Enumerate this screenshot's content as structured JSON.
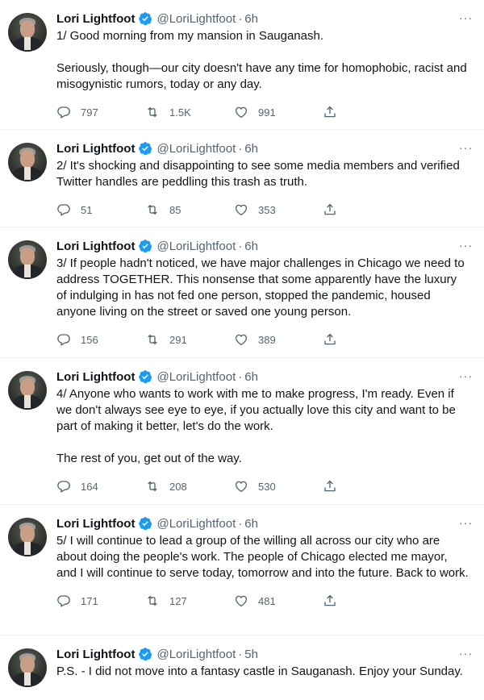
{
  "author": {
    "name": "Lori Lightfoot",
    "handle": "@LoriLightfoot"
  },
  "separator": "·",
  "more_label": "···",
  "tweets": [
    {
      "time": "6h",
      "text": "1/ Good morning from my mansion in Sauganash.\n\nSeriously, though—our city doesn't have any time for homophobic, racist and misogynistic rumors, today or any day.",
      "replies": "797",
      "retweets": "1.5K",
      "likes": "991"
    },
    {
      "time": "6h",
      "text": "2/ It's shocking and disappointing to see some media members and verified Twitter handles are peddling this trash as truth.",
      "replies": "51",
      "retweets": "85",
      "likes": "353"
    },
    {
      "time": "6h",
      "text": "3/ If people hadn't noticed, we have major challenges in Chicago we need to address TOGETHER. This nonsense that some apparently have the luxury of indulging in has not fed one person, stopped the pandemic, housed anyone living on the street or saved one young person.",
      "replies": "156",
      "retweets": "291",
      "likes": "389"
    },
    {
      "time": "6h",
      "text": "4/ Anyone who wants to work with me to make progress, I'm ready. Even if we don't always see eye to eye, if you actually love this city and want to be part of making it better, let's do the work.\n\nThe rest of you, get out of the way.",
      "replies": "164",
      "retweets": "208",
      "likes": "530"
    },
    {
      "time": "6h",
      "text": "5/ I will continue to lead a group of the willing all across our city who are about doing the people's work. The people of Chicago elected me mayor, and I will continue to serve today, tomorrow and into the future. Back to work.",
      "replies": "171",
      "retweets": "127",
      "likes": "481"
    },
    {
      "time": "5h",
      "text": "P.S. - I did not move into a fantasy castle in Sauganash. Enjoy your Sunday.",
      "replies": "",
      "retweets": "",
      "likes": ""
    }
  ],
  "colors": {
    "verified": "#1d9bf0",
    "secondary_text": "#536471",
    "divider": "#eff3f4"
  },
  "icons": [
    "verified-badge-icon",
    "more-icon",
    "reply-icon",
    "retweet-icon",
    "like-icon",
    "share-icon"
  ]
}
